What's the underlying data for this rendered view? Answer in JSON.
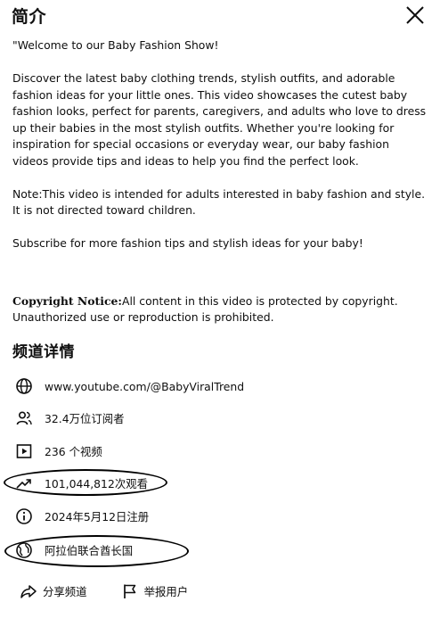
{
  "header": {
    "title": "简介",
    "close_icon": "close-icon"
  },
  "description": {
    "line1": "\"Welcome to our Baby Fashion Show!",
    "para1": "Discover the latest baby clothing trends, stylish outfits, and adorable fashion ideas for your little ones. This video showcases the cutest baby fashion looks, perfect for parents, caregivers, and adults who love to dress up their babies in the most stylish outfits. Whether you're looking for inspiration for special occasions or everyday wear, our baby fashion videos provide tips and ideas to help you find the perfect look.",
    "para2": "Note:This video is intended for adults interested in baby fashion and style. It is not directed toward children.",
    "para3": "Subscribe for more fashion tips and stylish ideas for your baby!",
    "notice_label": "Copyright Notice:",
    "notice_text": "All content in this video is protected by copyright. Unauthorized use or reproduction is prohibited."
  },
  "channel_details": {
    "title": "频道详情",
    "url": "www.youtube.com/@BabyViralTrend",
    "subscribers": "32.4万位订阅者",
    "videos": "236 个视频",
    "views": "101,044,812次观看",
    "joined": "2024年5月12日注册",
    "location": "阿拉伯联合酋长国"
  },
  "actions": {
    "share": "分享频道",
    "report": "举报用户"
  }
}
